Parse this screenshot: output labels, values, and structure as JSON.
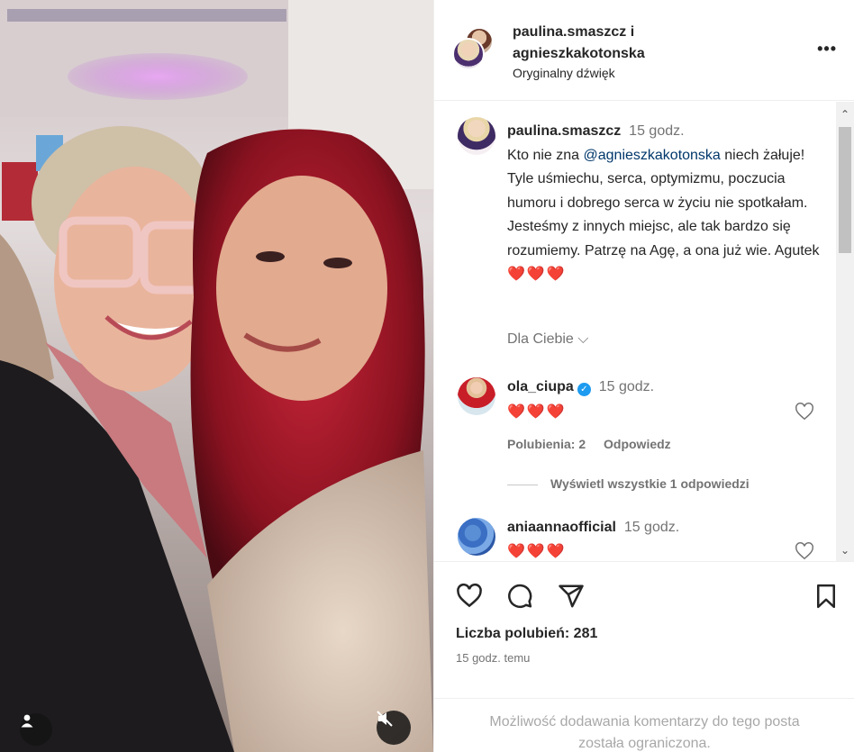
{
  "header": {
    "user1": "paulina.smaszcz i",
    "user2": "agnieszkakotonska",
    "audio": "Oryginalny dźwięk",
    "more_icon": "more-horizontal-icon"
  },
  "caption": {
    "username": "paulina.smaszcz",
    "time": "15 godz.",
    "text_before": "Kto nie zna ",
    "mention": "@agnieszkakotonska",
    "text_after": " niech żałuje! Tyle uśmiechu, serca, optymizmu, poczucia humoru i dobrego serca w życiu nie spotkałam. Jesteśmy z innych miejsc, ale tak bardzo się rozumiemy. Patrzę na Agę, a ona już wie. Agutek",
    "emoji": "❤️❤️❤️"
  },
  "dla_ciebie": "Dla Ciebie",
  "comments": [
    {
      "username": "ola_ciupa",
      "verified": true,
      "time": "15 godz.",
      "text": "❤️❤️❤️",
      "likes": "Polubienia: 2",
      "reply": "Odpowiedz"
    },
    {
      "username": "aniaannaofficial",
      "time": "15 godz.",
      "text": "❤️❤️❤️"
    }
  ],
  "view_replies": "Wyświetl wszystkie 1 odpowiedzi",
  "likes_count": "Liczba polubień: 281",
  "post_time": "15 godz. temu",
  "restricted_notice": "Możliwość dodawania komentarzy do tego posta została ograniczona.",
  "colors": {
    "heart": "#e01020",
    "mention": "#00376b",
    "muted": "#737373"
  }
}
